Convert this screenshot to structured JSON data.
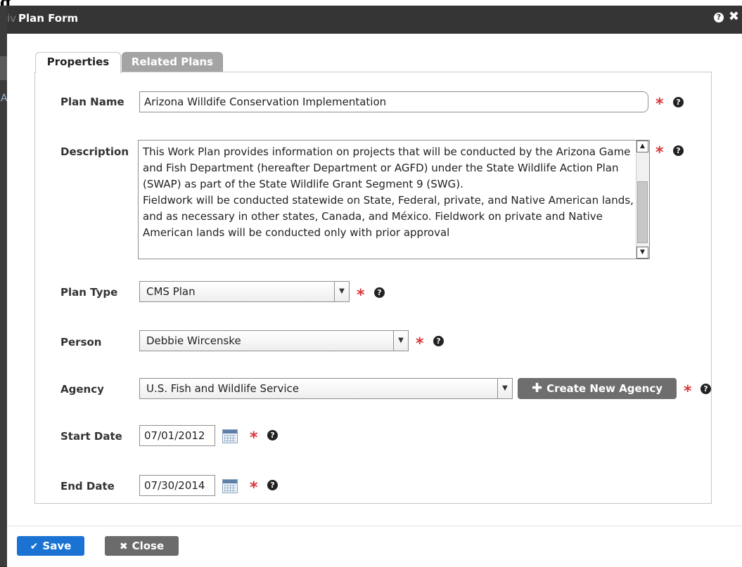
{
  "background": {
    "heading": "g",
    "title_fragment": "iv",
    "left_letter": "A"
  },
  "dialog": {
    "title": "Plan Form",
    "help_icon": "question-circle-icon",
    "close_glyph": "✖"
  },
  "tabs": [
    {
      "label": "Properties",
      "active": true
    },
    {
      "label": "Related Plans",
      "active": false
    }
  ],
  "form": {
    "plan_name": {
      "label": "Plan Name",
      "value": "Arizona Willdife Conservation Implementation",
      "required": true
    },
    "description": {
      "label": "Description",
      "value": "This Work Plan provides information on projects that will be conducted by the Arizona Game and Fish Department (hereafter Department or AGFD) under the State Wildlife Action Plan (SWAP) as part of the State Wildlife Grant Segment 9 (SWG).\nFieldwork will be conducted statewide on State, Federal, private, and Native American lands, and as necessary in other states, Canada, and México. Fieldwork on private and Native American lands will be conducted only with prior approval",
      "required": true
    },
    "plan_type": {
      "label": "Plan Type",
      "value": "CMS Plan",
      "required": true
    },
    "person": {
      "label": "Person",
      "value": "Debbie Wircenske",
      "required": true
    },
    "agency": {
      "label": "Agency",
      "value": "U.S. Fish and Wildlife Service",
      "required": true,
      "create_button": "Create New Agency"
    },
    "start_date": {
      "label": "Start Date",
      "value": "07/01/2012",
      "required": true
    },
    "end_date": {
      "label": "End Date",
      "value": "07/30/2014",
      "required": true
    }
  },
  "required_mark": "*",
  "help_mark": "?",
  "footer": {
    "save_label": "Save",
    "close_label": "Close"
  },
  "colors": {
    "primary": "#1a73d2",
    "required": "#d9363a",
    "titlebar": "#353535",
    "secondary_button": "#6b6b6b"
  }
}
